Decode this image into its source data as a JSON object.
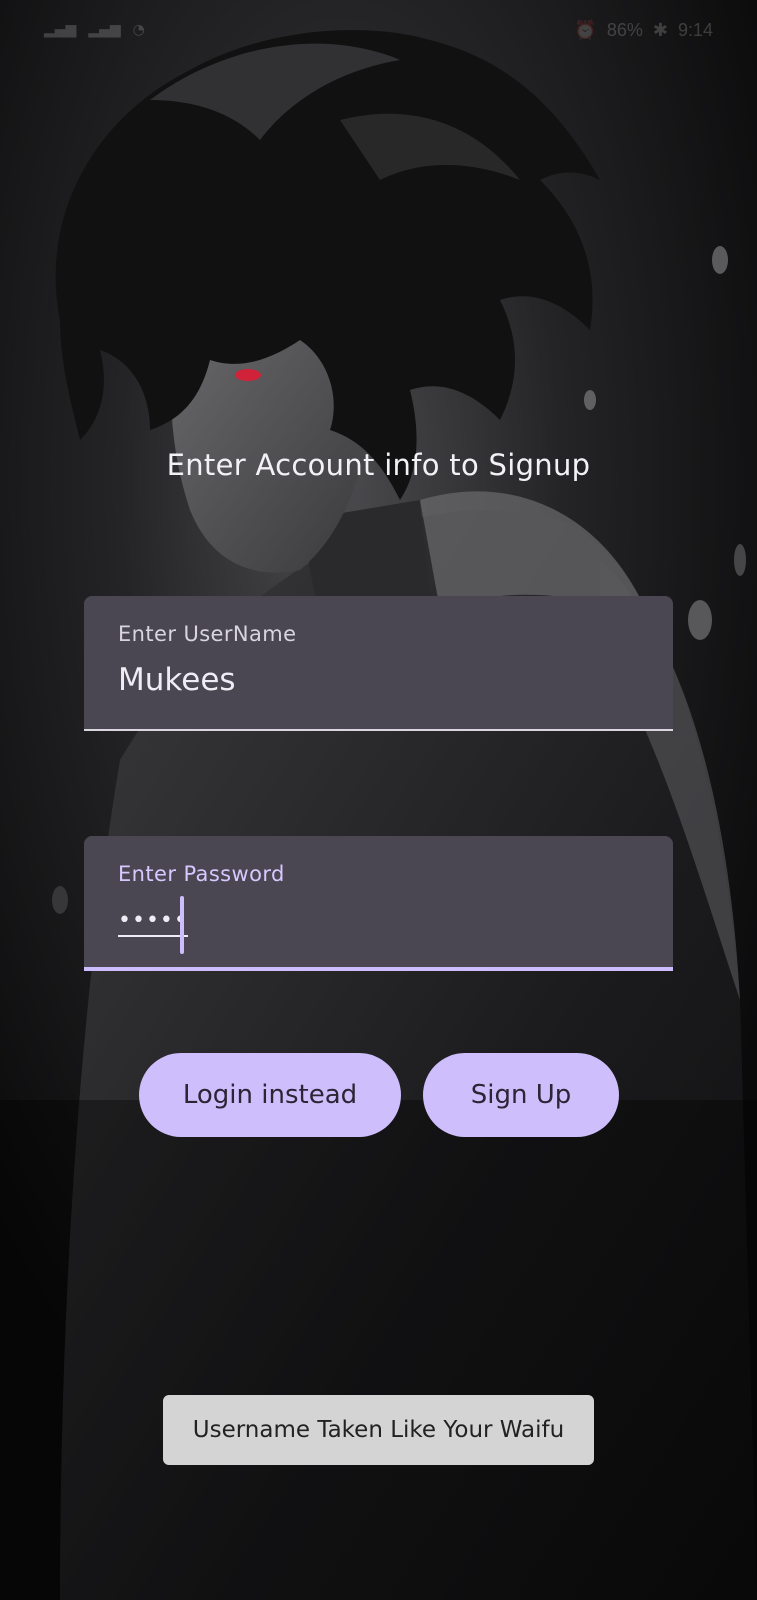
{
  "status_bar": {
    "battery": "86%",
    "time": "9:14",
    "signal_icon": "signal-bars-icon",
    "wifi_icon": "wifi-icon",
    "alarm_icon": "alarm-icon",
    "bluetooth_icon": "bluetooth-icon"
  },
  "background": {
    "description_icon": "anime-character-artwork"
  },
  "screen": {
    "title": "Enter Account info to Signup"
  },
  "username_field": {
    "label": "Enter UserName",
    "value": "Mukees"
  },
  "password_field": {
    "label": "Enter Password",
    "masked_value": "•••••"
  },
  "buttons": {
    "login_label": "Login instead",
    "signup_label": "Sign Up"
  },
  "toast": {
    "message": "Username Taken Like Your Waifu"
  },
  "colors": {
    "accent": "#cfbefc",
    "field_bg": "#4a4652",
    "toast_bg": "#d4d4d4",
    "background": "#0b0b0c"
  }
}
